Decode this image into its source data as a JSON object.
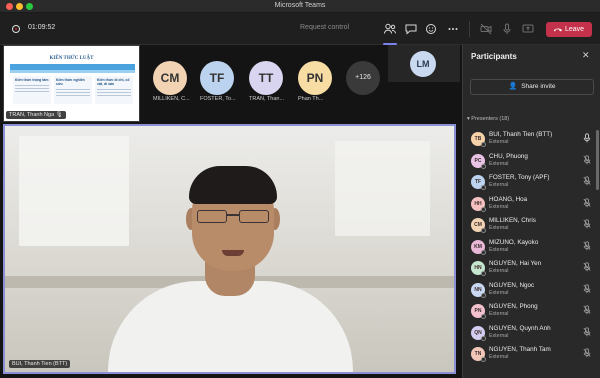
{
  "window": {
    "title": "Microsoft Teams"
  },
  "toolbar": {
    "timer": "01:09:52",
    "request_control": "Request control",
    "leave_label": "Leave",
    "icons": [
      "people-icon",
      "chat-icon",
      "reactions-icon",
      "more-icon",
      "camera-off-icon",
      "mic-icon",
      "share-screen-icon"
    ]
  },
  "stage": {
    "shared_screen": {
      "presenter_name": "TRAN, Thanh Nga",
      "doc_title": "KIẾN THỨC LUẬT",
      "columns": [
        "Kiến thức trọng tâm",
        "Kiến thức nghiên cứu",
        "Kiến thức di chỉ, cổ vật, di sản"
      ]
    },
    "tiles": [
      {
        "initials": "CM",
        "name": "MILLIKEN, C...",
        "color": "#f2d3b3"
      },
      {
        "initials": "TF",
        "name": "FOSTER, To...",
        "color": "#bcd3ef"
      },
      {
        "initials": "TT",
        "name": "TRAN, Than...",
        "color": "#d9d4ef"
      },
      {
        "initials": "PN",
        "name": "Phan Th...",
        "color": "#f7dca4"
      }
    ],
    "overflow_count": "+126",
    "lm_initials": "LM",
    "main_video_name": "BUI, Thanh Tien (BTT)"
  },
  "panel": {
    "title": "Participants",
    "share_invite": "Share invite",
    "presenters_label": "Presenters (18)",
    "participants": [
      {
        "initials": "TB",
        "name": "BUI, Thanh Tien (BTT)",
        "sub": "External",
        "color": "#f6d2a9",
        "mic": "on"
      },
      {
        "initials": "PC",
        "name": "CHU, Phuong",
        "sub": "External",
        "color": "#e9c3e6",
        "mic": "off"
      },
      {
        "initials": "TF",
        "name": "FOSTER, Tony (APF)",
        "sub": "External",
        "color": "#bcd3ef",
        "mic": "off"
      },
      {
        "initials": "HH",
        "name": "HOANG, Hoa",
        "sub": "External",
        "color": "#f4c0c0",
        "mic": "off"
      },
      {
        "initials": "CM",
        "name": "MILLIKEN, Chris",
        "sub": "External",
        "color": "#f2d3b3",
        "mic": "off"
      },
      {
        "initials": "KM",
        "name": "MIZUNO, Kayoko",
        "sub": "External",
        "color": "#e8b8d6",
        "mic": "off"
      },
      {
        "initials": "HN",
        "name": "NGUYEN, Hai Yen",
        "sub": "External",
        "color": "#c6e6cf",
        "mic": "off"
      },
      {
        "initials": "NN",
        "name": "NGUYEN, Ngoc",
        "sub": "External",
        "color": "#c8d8f2",
        "mic": "off"
      },
      {
        "initials": "PN",
        "name": "NGUYEN, Phong",
        "sub": "External",
        "color": "#f4c2ce",
        "mic": "off"
      },
      {
        "initials": "QN",
        "name": "NGUYEN, Quynh Anh",
        "sub": "External",
        "color": "#d3cdf0",
        "mic": "off"
      },
      {
        "initials": "TN",
        "name": "NGUYEN, Thanh Tam",
        "sub": "External",
        "color": "#f3c7b8",
        "mic": "off"
      }
    ]
  }
}
